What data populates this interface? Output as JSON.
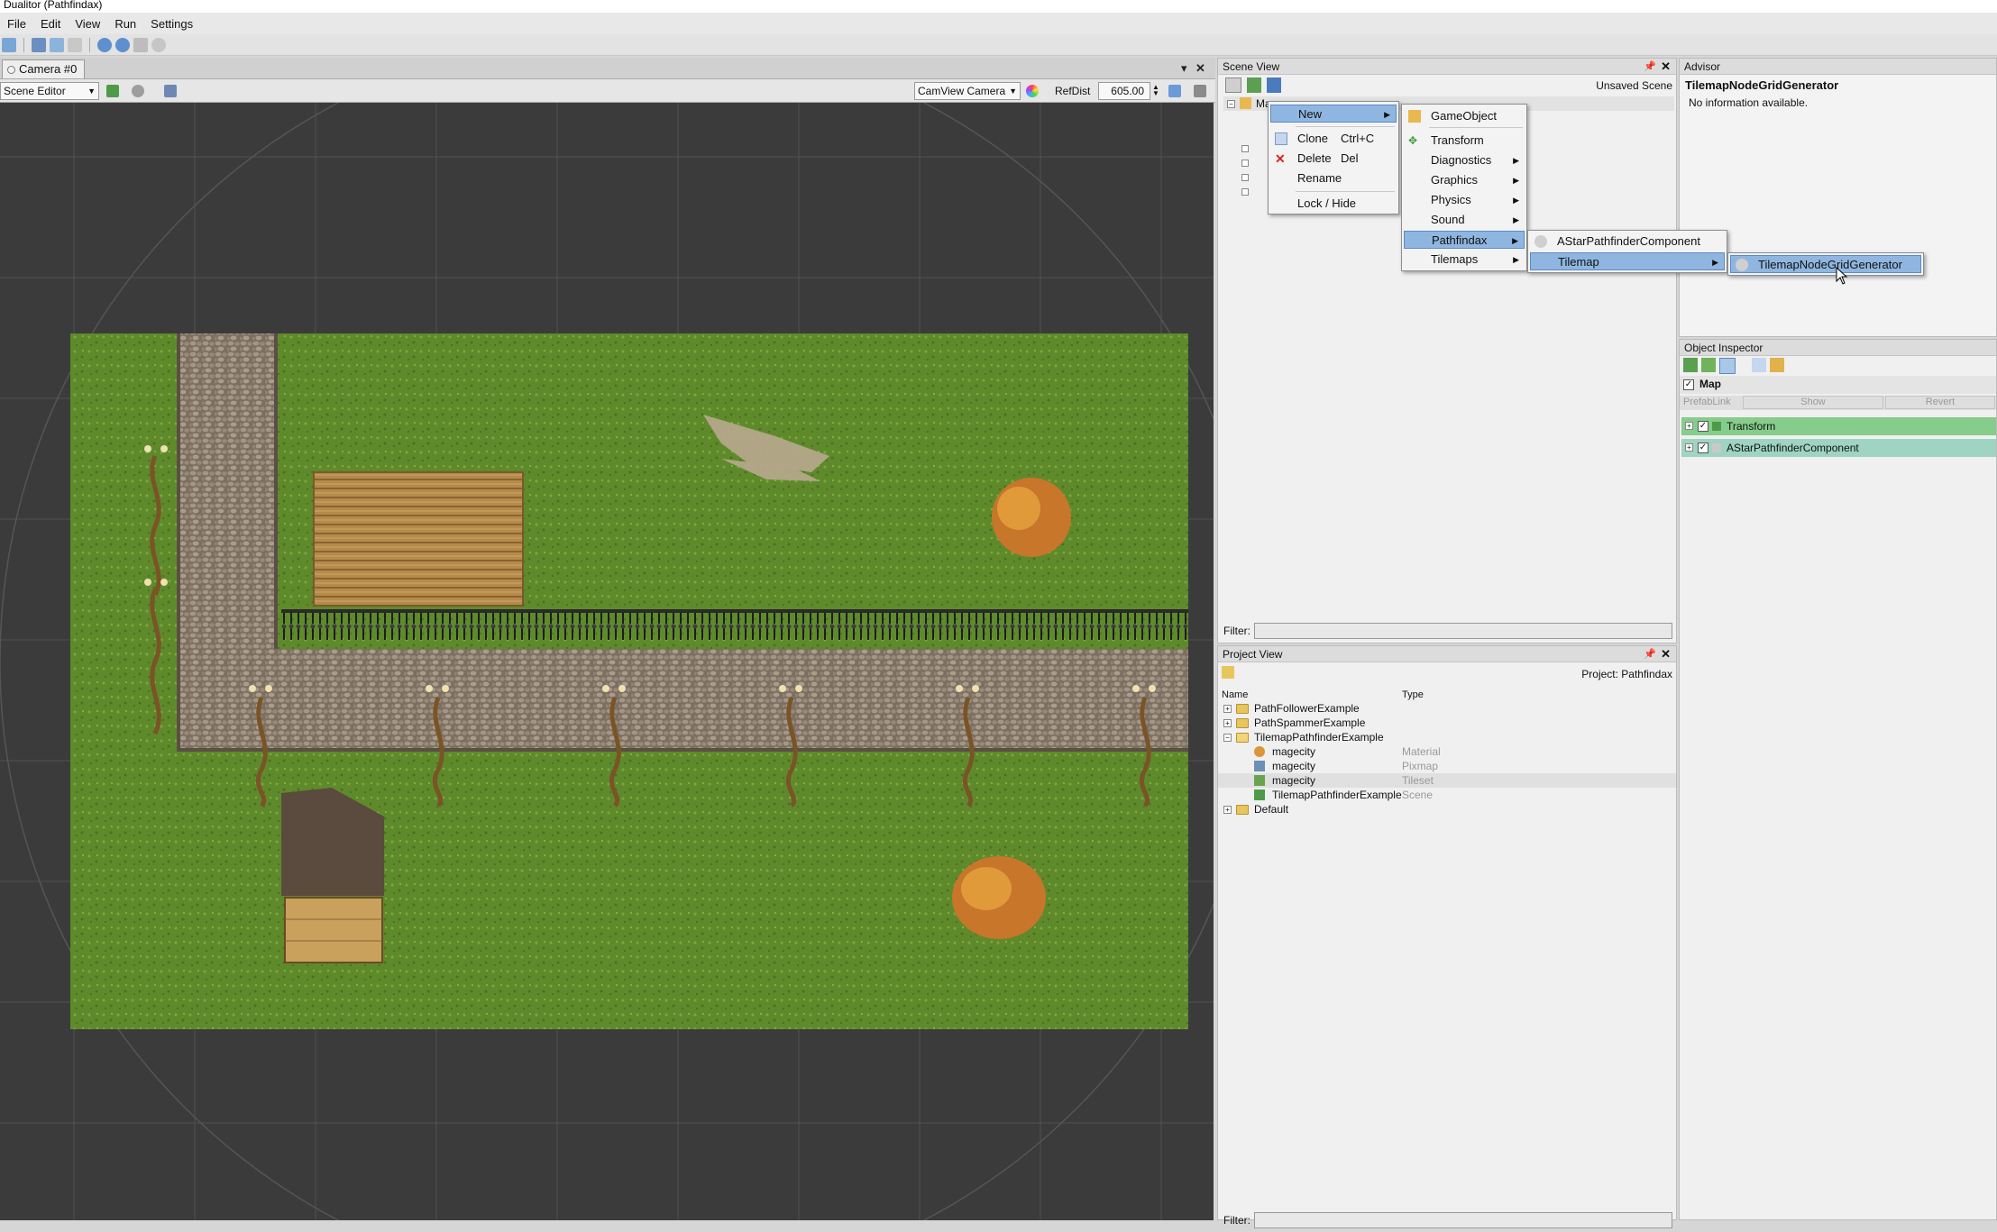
{
  "window": {
    "title": "Dualitor (Pathfindax)"
  },
  "menubar": [
    "File",
    "Edit",
    "View",
    "Run",
    "Settings"
  ],
  "camera_panel": {
    "tab_label": "Camera #0",
    "editor_mode": "Scene Editor",
    "camera_select": "CamView Camera",
    "refdist_label": "RefDist",
    "refdist_value": "605.00"
  },
  "scene_view": {
    "title": "Scene View",
    "status": "Unsaved Scene",
    "root_node": "Map",
    "filter_label": "Filter:"
  },
  "context_menu": {
    "items": [
      {
        "label": "New",
        "has_submenu": true,
        "highlighted": true
      },
      {
        "label": "Clone",
        "shortcut": "Ctrl+C"
      },
      {
        "label": "Delete",
        "shortcut": "Del"
      },
      {
        "label": "Rename"
      },
      {
        "label": "Lock / Hide"
      }
    ]
  },
  "new_submenu": {
    "items": [
      {
        "label": "GameObject"
      },
      {
        "label": "Transform"
      },
      {
        "label": "Diagnostics",
        "has_submenu": true
      },
      {
        "label": "Graphics",
        "has_submenu": true
      },
      {
        "label": "Physics",
        "has_submenu": true
      },
      {
        "label": "Sound",
        "has_submenu": true
      },
      {
        "label": "Pathfindax",
        "has_submenu": true,
        "highlighted": true
      },
      {
        "label": "Tilemaps",
        "has_submenu": true
      }
    ]
  },
  "pathfindax_submenu": {
    "items": [
      {
        "label": "AStarPathfinderComponent"
      },
      {
        "label": "Tilemap",
        "has_submenu": true,
        "highlighted": true
      }
    ]
  },
  "tilemap_submenu": {
    "items": [
      {
        "label": "TilemapNodeGridGenerator",
        "highlighted": true
      }
    ]
  },
  "project_view": {
    "title": "Project View",
    "project_label": "Project: Pathfindax",
    "columns": [
      "Name",
      "Type"
    ],
    "rows": [
      {
        "name": "PathFollowerExample",
        "type": "",
        "kind": "folder"
      },
      {
        "name": "PathSpammerExample",
        "type": "",
        "kind": "folder"
      },
      {
        "name": "TilemapPathfinderExample",
        "type": "",
        "kind": "folder-open"
      },
      {
        "name": "magecity",
        "type": "Material",
        "kind": "material"
      },
      {
        "name": "magecity",
        "type": "Pixmap",
        "kind": "pixmap"
      },
      {
        "name": "magecity",
        "type": "Tileset",
        "kind": "tileset"
      },
      {
        "name": "TilemapPathfinderExample",
        "type": "Scene",
        "kind": "scene"
      },
      {
        "name": "Default",
        "type": "",
        "kind": "folder"
      }
    ],
    "filter_label": "Filter:"
  },
  "advisor": {
    "title": "Advisor",
    "heading": "TilemapNodeGridGenerator",
    "body": "No information available."
  },
  "object_inspector": {
    "title": "Object Inspector",
    "object_name": "Map",
    "prefab_buttons": [
      "PrefabLink",
      "Show",
      "Revert"
    ],
    "components": [
      "Transform",
      "AStarPathfinderComponent"
    ]
  },
  "colors": {
    "component_green": "#86cc8a",
    "component_teal": "#9ed4c1",
    "menu_highlight": "#8fb6e0",
    "viewport_bg": "#3b3b3b",
    "grass": "#5f8a2c",
    "cobblestone": "#8f8172"
  }
}
